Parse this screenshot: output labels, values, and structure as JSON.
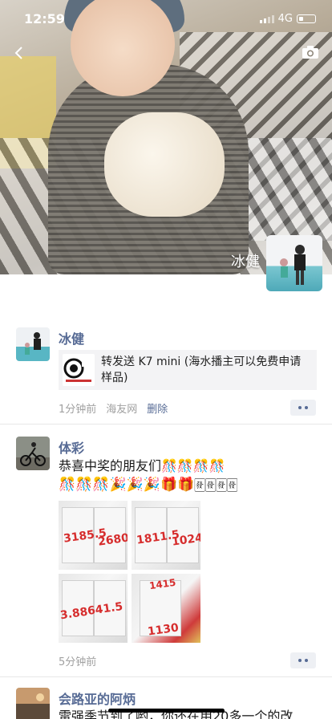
{
  "status_bar": {
    "time": "12:59",
    "network": "4G"
  },
  "cover": {
    "owner_name": "冰健"
  },
  "posts": [
    {
      "author": "冰健",
      "link_text": "转发送 K7 mini (海水播主可以免费申请样品)",
      "time": "1分钟前",
      "source": "海友网",
      "delete_label": "删除"
    },
    {
      "author": "体彩",
      "text": "恭喜中奖的朋友们🎊🎊🎊🎊",
      "emojis": "🎊🎊🎊🎉🎉🎉🎁🎁🀅🀅🀅🀅",
      "tickets": [
        "3185.5",
        "2680.5",
        "1811.5",
        "1024.5",
        "3.88",
        "641.5",
        "1415",
        "1130"
      ],
      "time": "5分钟前"
    },
    {
      "author": "会路亚的阿炳",
      "text": "雷强季节到了哟，你还在用20多一个的改"
    }
  ],
  "colors": {
    "link_blue": "#576b95",
    "meta_gray": "#a0a0a0"
  }
}
